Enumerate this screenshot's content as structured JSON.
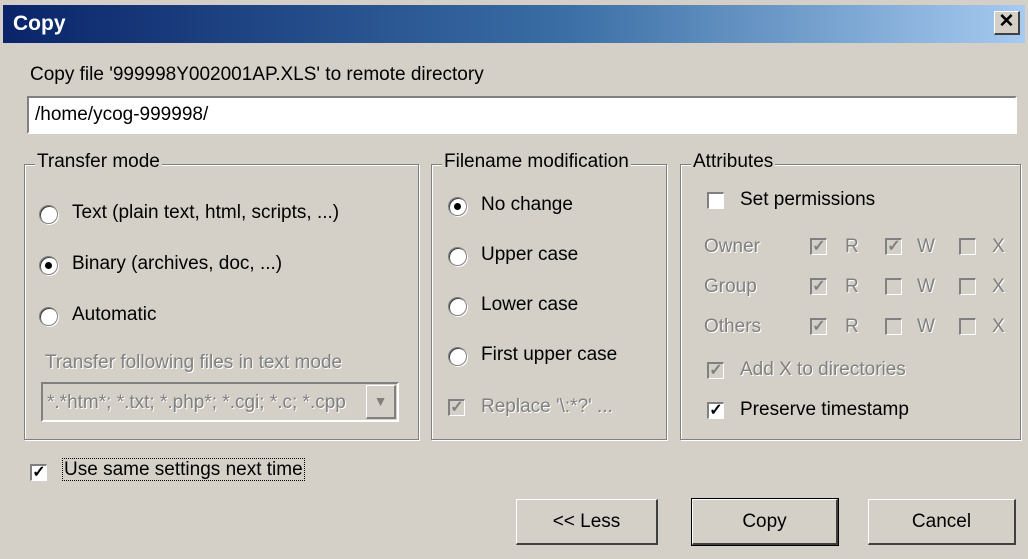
{
  "window": {
    "title": "Copy",
    "close_glyph": "✕"
  },
  "prompt_label": "Copy file '999998Y002001AP.XLS' to remote directory",
  "remote_path": {
    "value": "/home/ycog-999998/"
  },
  "transfer_mode": {
    "legend": "Transfer mode",
    "options": [
      {
        "label": "Text (plain text, html, scripts, ...)",
        "checked": false
      },
      {
        "label": "Binary (archives, doc, ...)",
        "checked": true
      },
      {
        "label": "Automatic",
        "checked": false
      }
    ],
    "text_mode_label": "Transfer following files in text mode",
    "text_mode_mask": "*.*htm*; *.txt; *.php*; *.cgi; *.c; *.cpp"
  },
  "filename_modification": {
    "legend": "Filename modification",
    "options": [
      {
        "label": "No change",
        "checked": true
      },
      {
        "label": "Upper case",
        "checked": false
      },
      {
        "label": "Lower case",
        "checked": false
      },
      {
        "label": "First upper case",
        "checked": false
      }
    ],
    "replace_label": "Replace '\\:*?' ...",
    "replace_checked": true
  },
  "attributes": {
    "legend": "Attributes",
    "set_permissions_label": "Set permissions",
    "set_permissions_checked": false,
    "rows": [
      {
        "label": "Owner",
        "r": true,
        "w": true,
        "x": false
      },
      {
        "label": "Group",
        "r": true,
        "w": false,
        "x": false
      },
      {
        "label": "Others",
        "r": true,
        "w": false,
        "x": false
      }
    ],
    "perm_labels": {
      "r": "R",
      "w": "W",
      "x": "X"
    },
    "add_x_label": "Add X to directories",
    "add_x_checked": true,
    "preserve_label": "Preserve timestamp",
    "preserve_checked": true
  },
  "use_same_settings": {
    "label": "Use same settings next time",
    "checked": true
  },
  "buttons": {
    "less": "<< Less",
    "copy": "Copy",
    "cancel": "Cancel"
  }
}
